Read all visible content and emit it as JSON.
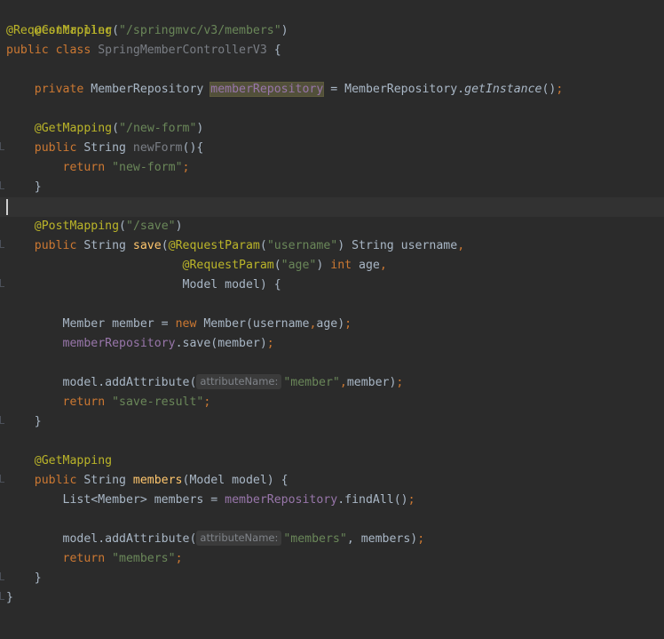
{
  "editor": {
    "lines": {
      "l1": {
        "a": "@Controller"
      },
      "l2": {
        "a": "@RequestMapping",
        "b": "(",
        "c": "\"/springmvc/v3/members\"",
        "d": ")"
      },
      "l3": {
        "a": "public class ",
        "b": "SpringMemberControllerV3",
        "c": " {"
      },
      "l5": {
        "a": "private ",
        "b": "MemberRepository ",
        "c": "memberRepository",
        "d": " = MemberRepository.",
        "e": "getInstance",
        "f": "()",
        "g": ";"
      },
      "l7": {
        "a": "@GetMapping",
        "b": "(",
        "c": "\"/new-form\"",
        "d": ")"
      },
      "l8": {
        "a": "public ",
        "b": "String ",
        "c": "newForm",
        "d": "(){"
      },
      "l9": {
        "a": "return ",
        "b": "\"new-form\"",
        "c": ";"
      },
      "l10": {
        "a": "}"
      },
      "l12": {
        "a": "@PostMapping",
        "b": "(",
        "c": "\"/save\"",
        "d": ")"
      },
      "l13": {
        "a": "public ",
        "b": "String ",
        "c": "save",
        "d": "(",
        "e": "@RequestParam",
        "f": "(",
        "g": "\"username\"",
        "h": ") String username",
        "i": ","
      },
      "l14": {
        "a": "@RequestParam",
        "b": "(",
        "c": "\"age\"",
        "d": ") ",
        "e": "int ",
        "f": "age",
        "g": ","
      },
      "l15": {
        "a": "Model model) {"
      },
      "l17": {
        "a": "Member member = ",
        "b": "new ",
        "c": "Member(username",
        "d": ",",
        "e": "age)",
        "f": ";"
      },
      "l18": {
        "a": "memberRepository",
        "b": ".save(member)",
        "c": ";"
      },
      "l20": {
        "a": "model.addAttribute(",
        "hint": "attributeName:",
        "b": "\"member\"",
        "c": ",",
        "d": "member)",
        "e": ";"
      },
      "l21": {
        "a": "return ",
        "b": "\"save-result\"",
        "c": ";"
      },
      "l22": {
        "a": "}"
      },
      "l24": {
        "a": "@GetMapping"
      },
      "l25": {
        "a": "public ",
        "b": "String ",
        "c": "members",
        "d": "(Model model) {"
      },
      "l26": {
        "a": "List<Member> members = ",
        "b": "memberRepository",
        "c": ".findAll()",
        "d": ";"
      },
      "l28": {
        "a": "model.addAttribute(",
        "hint": "attributeName:",
        "b": "\"members\"",
        "c": ", members)",
        "d": ";"
      },
      "l29": {
        "a": "return ",
        "b": "\"members\"",
        "c": ";"
      },
      "l30": {
        "a": "}"
      },
      "l31": {
        "a": "}"
      }
    }
  }
}
